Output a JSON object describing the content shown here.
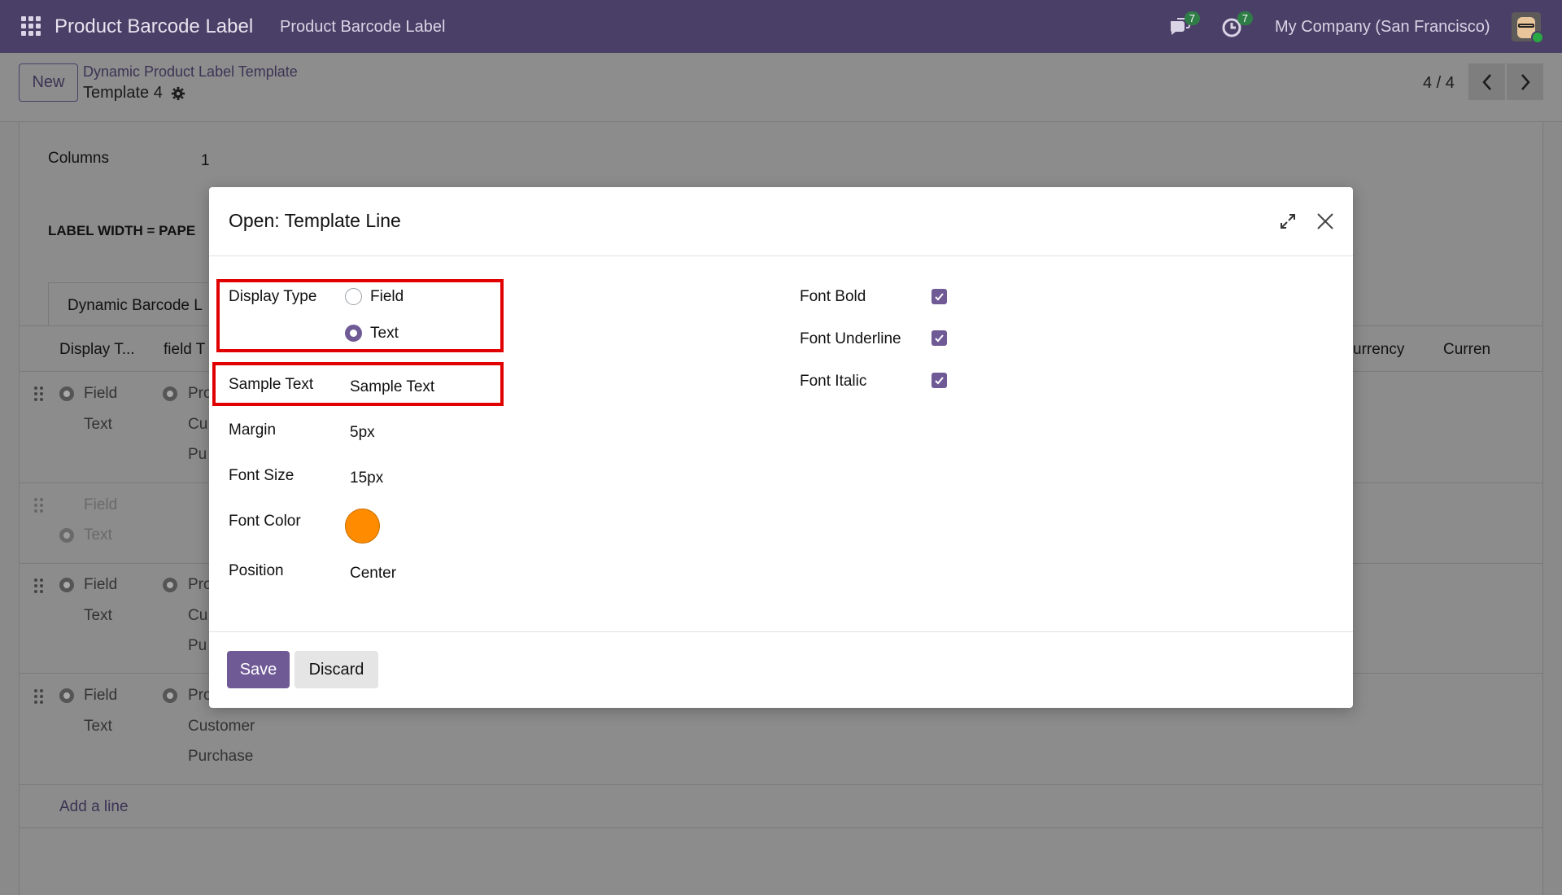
{
  "navbar": {
    "brand": "Product Barcode Label",
    "menu_item": "Product Barcode Label",
    "messages_count": "7",
    "activities_count": "7",
    "company": "My Company (San Francisco)"
  },
  "control_panel": {
    "new_label": "New",
    "breadcrumb_parent": "Dynamic Product Label Template",
    "breadcrumb_current": "Template 4",
    "pager": "4 / 4"
  },
  "background": {
    "columns_label": "Columns",
    "columns_value": "1",
    "label_width_text": "LABEL WIDTH = PAPE",
    "tab_label": "Dynamic Barcode L",
    "col_display_type": "Display T...",
    "col_field": "field T",
    "col_currency": "urrency",
    "col_curren": "Curren",
    "rows": [
      {
        "a": "Field",
        "b": "Text",
        "c1": "Pro",
        "c2": "Cu",
        "c3": "Pu"
      },
      {
        "a": "Field",
        "b": "Text"
      },
      {
        "a": "Field",
        "b": "Text",
        "c1": "Pro",
        "c2": "Cu",
        "c3": "Pu"
      },
      {
        "a": "Field",
        "b": "Text",
        "c1": "Pro",
        "c2": "Customer",
        "c3": "Purchase"
      }
    ],
    "add_line": "Add a line"
  },
  "modal": {
    "title": "Open: Template Line",
    "display_type_label": "Display Type",
    "display_type_options": [
      "Field",
      "Text"
    ],
    "display_type_selected": "Text",
    "sample_text_label": "Sample Text",
    "sample_text_value": "Sample Text",
    "margin_label": "Margin",
    "margin_value": "5px",
    "font_size_label": "Font Size",
    "font_size_value": "15px",
    "font_color_label": "Font Color",
    "font_color_value": "#ff8c00",
    "position_label": "Position",
    "position_value": "Center",
    "font_bold_label": "Font Bold",
    "font_bold_checked": true,
    "font_underline_label": "Font Underline",
    "font_underline_checked": true,
    "font_italic_label": "Font Italic",
    "font_italic_checked": true,
    "save_label": "Save",
    "discard_label": "Discard"
  },
  "colors": {
    "navbar": "#4a3f66",
    "primary": "#6f5a96",
    "highlight": "#e00000",
    "badge": "#2f7d46"
  }
}
